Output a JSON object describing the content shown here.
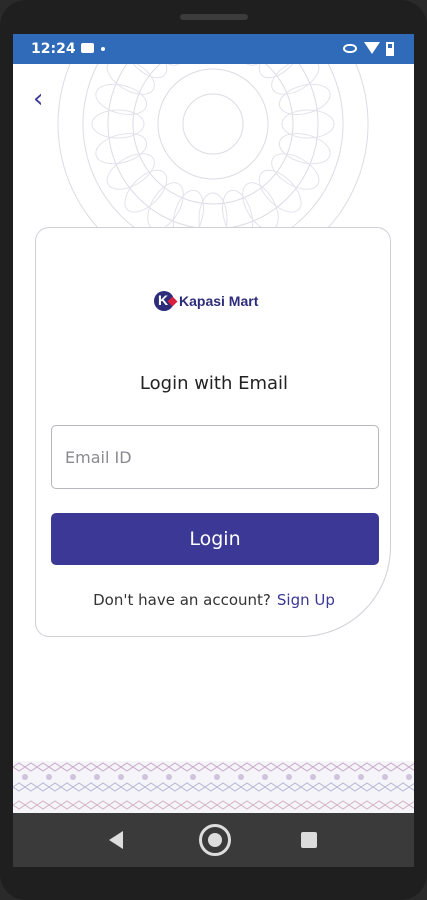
{
  "status_bar": {
    "time": "12:24",
    "icons": [
      "message-icon",
      "dot-icon",
      "eye-icon",
      "wifi-icon",
      "battery-icon"
    ]
  },
  "header": {
    "back_icon": "chevron-left-icon"
  },
  "brand": {
    "name": "Kapasi Mart",
    "mark_letter": "K"
  },
  "form": {
    "title": "Login with Email",
    "email_placeholder": "Email ID",
    "email_value": "",
    "login_label": "Login",
    "signup_prompt": "Don't have an account?",
    "signup_link": "Sign Up"
  },
  "nav_bar": {
    "icons": [
      "back-triangle-icon",
      "home-circle-icon",
      "recents-square-icon"
    ]
  },
  "colors": {
    "accent": "#3b3896",
    "status_bar": "#2f6bb8",
    "brand_red": "#d81f3c"
  }
}
